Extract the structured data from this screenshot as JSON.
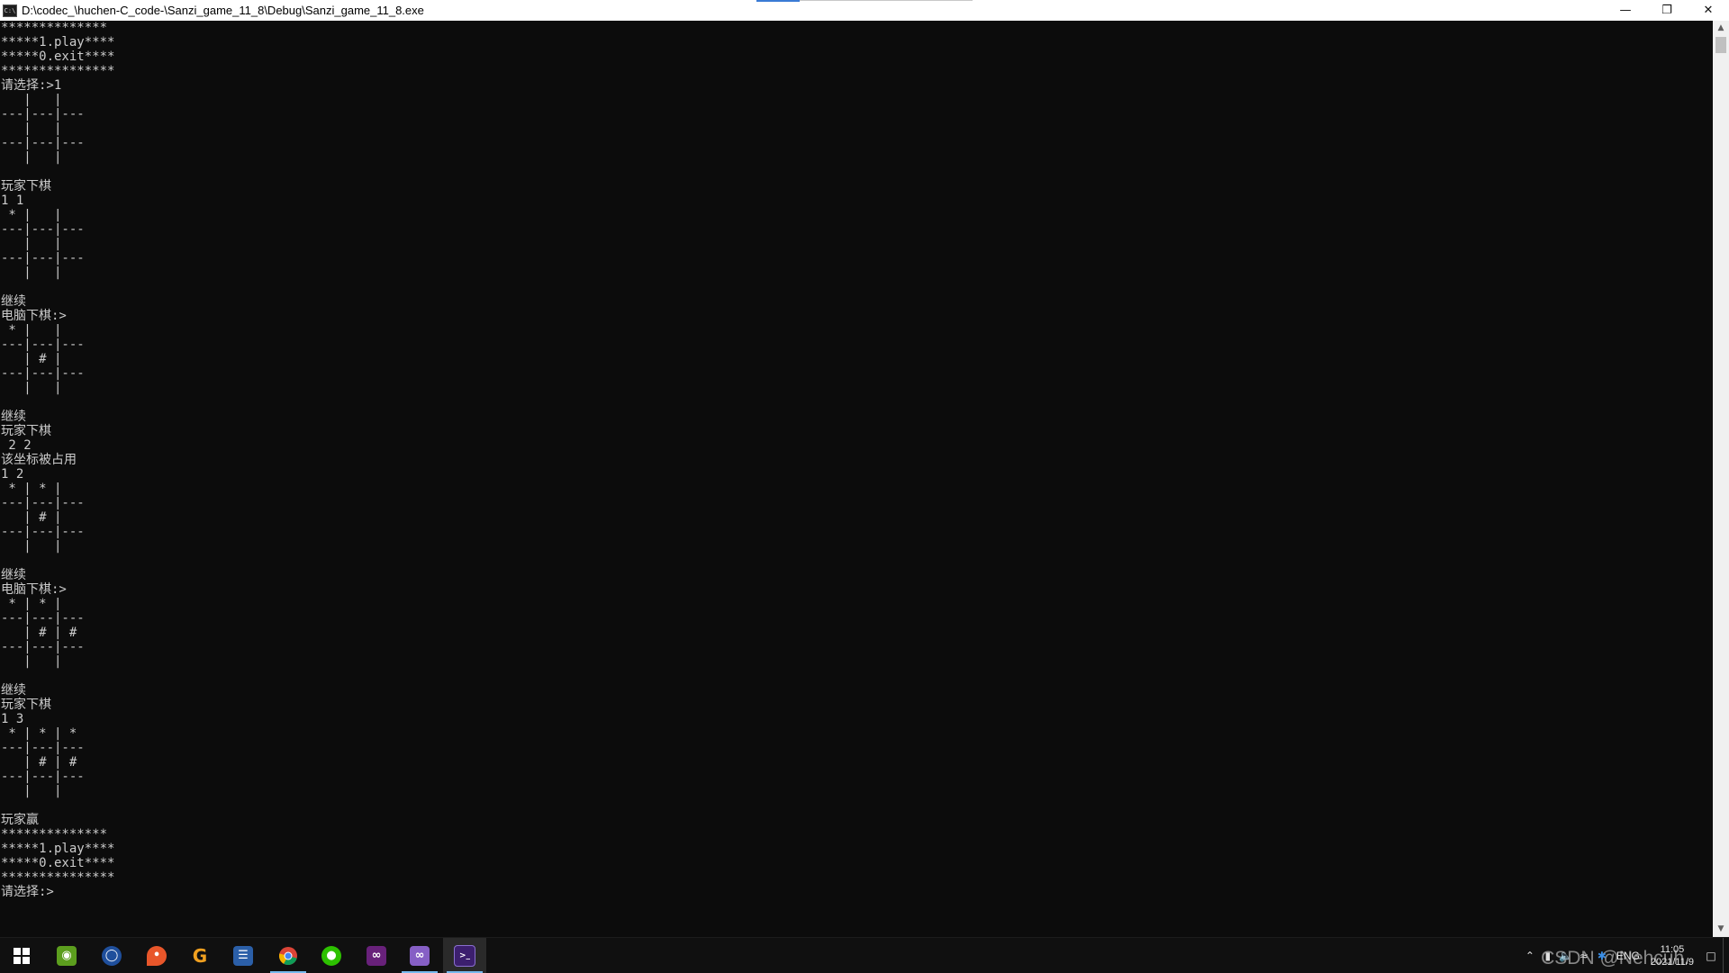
{
  "window": {
    "title": "D:\\codec_\\huchen-C_code-\\Sanzi_game_11_8\\Debug\\Sanzi_game_11_8.exe",
    "icon_text": "C:\\",
    "minimize_icon": "minimize-icon",
    "restore_icon": "restore-icon",
    "close_icon": "close-icon"
  },
  "console": {
    "lines": [
      "**************",
      "*****1.play****",
      "*****0.exit****",
      "***************",
      "请选择:>1",
      "   |   |   ",
      "---|---|---",
      "   |   |   ",
      "---|---|---",
      "   |   |   ",
      "",
      "玩家下棋",
      "1 1",
      " * |   |   ",
      "---|---|---",
      "   |   |   ",
      "---|---|---",
      "   |   |   ",
      "",
      "继续",
      "电脑下棋:>",
      " * |   |   ",
      "---|---|---",
      "   | # |   ",
      "---|---|---",
      "   |   |   ",
      "",
      "继续",
      "玩家下棋",
      " 2 2",
      "该坐标被占用",
      "1 2",
      " * | * |   ",
      "---|---|---",
      "   | # |   ",
      "---|---|---",
      "   |   |   ",
      "",
      "继续",
      "电脑下棋:>",
      " * | * |   ",
      "---|---|---",
      "   | # | # ",
      "---|---|---",
      "   |   |   ",
      "",
      "继续",
      "玩家下棋",
      "1 3",
      " * | * | * ",
      "---|---|---",
      "   | # | # ",
      "---|---|---",
      "   |   |   ",
      "",
      "玩家赢",
      "**************",
      "*****1.play****",
      "*****0.exit****",
      "***************",
      "请选择:>"
    ]
  },
  "scrollbar": {
    "up_icon": "▲",
    "down_icon": "▼"
  },
  "taskbar": {
    "items": [
      {
        "name": "start",
        "icon": "windows-logo"
      },
      {
        "name": "nvidia",
        "icon": "nvidia-icon"
      },
      {
        "name": "app-blue",
        "icon": "blue-circle-app-icon"
      },
      {
        "name": "app-orange",
        "icon": "orange-pin-icon"
      },
      {
        "name": "app-g",
        "icon": "g-icon"
      },
      {
        "name": "app-doc",
        "icon": "document-app-icon"
      },
      {
        "name": "chrome",
        "icon": "chrome-icon"
      },
      {
        "name": "wechat",
        "icon": "wechat-icon"
      },
      {
        "name": "vs-purple",
        "icon": "visual-studio-icon"
      },
      {
        "name": "vs",
        "icon": "visual-studio-icon"
      },
      {
        "name": "console",
        "icon": "console-icon"
      }
    ],
    "tray": {
      "lang": "ENG",
      "time": "11:05",
      "date": "2021/11/9"
    },
    "watermark": "CSDN @Nehcuh."
  },
  "colors": {
    "console_bg": "#0c0c0c",
    "console_fg": "#cccccc",
    "taskbar_bg": "#101010",
    "active_indicator": "#76b9ed"
  }
}
